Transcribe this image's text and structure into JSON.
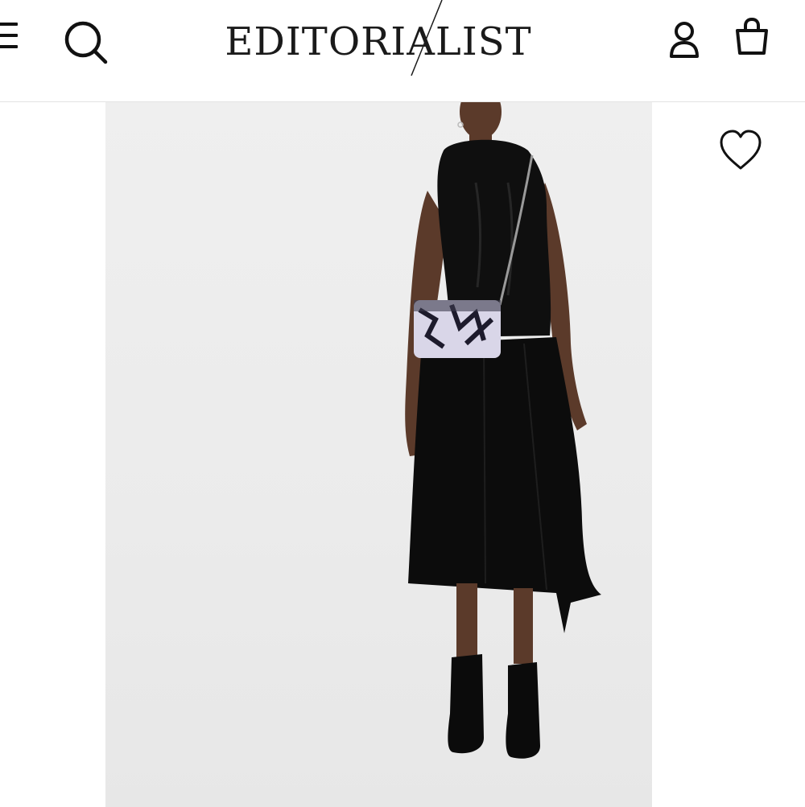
{
  "header": {
    "logo_text": "EDITORIALIST",
    "menu_icon": "hamburger-menu-icon",
    "search_icon": "search-icon",
    "account_icon": "user-icon",
    "bag_icon": "shopping-bag-icon"
  },
  "product": {
    "image": "model-wearing-black-cable-knit-halter-top-pleated-midi-skirt-printed-crossbody-bag",
    "wishlist_icon": "heart-outline-icon"
  },
  "colors": {
    "text": "#111111",
    "photo_background": "#ececec",
    "divider": "#e3e3e3"
  }
}
